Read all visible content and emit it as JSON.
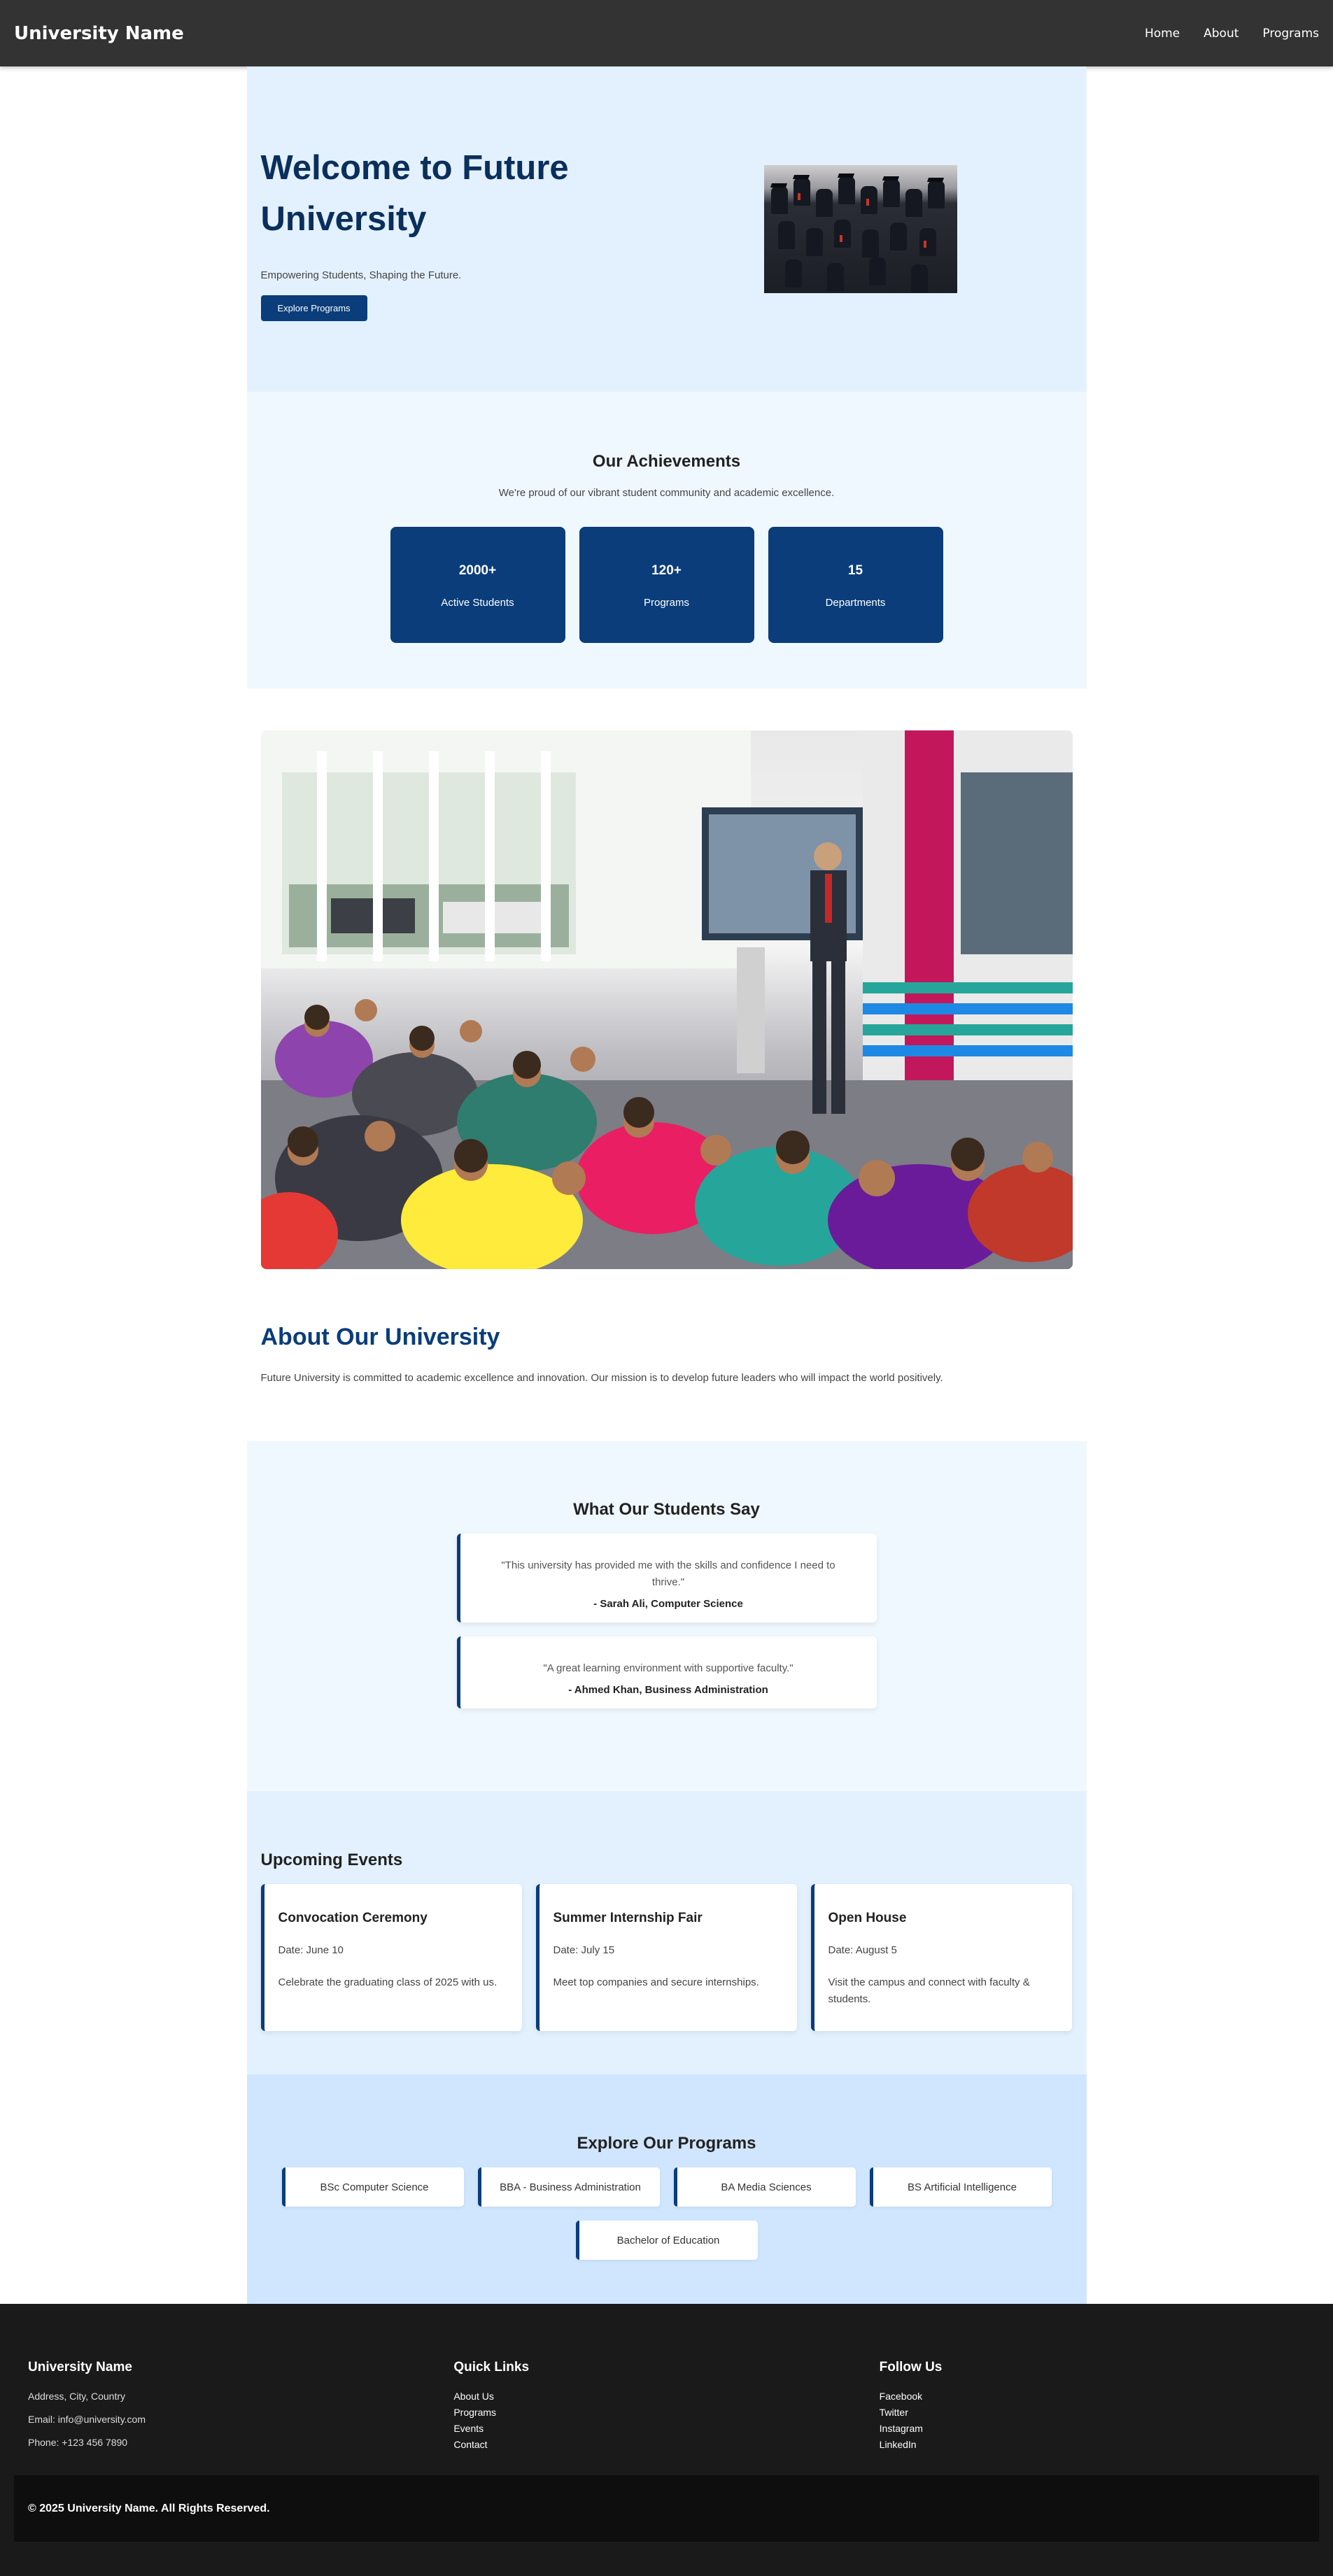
{
  "nav": {
    "brand": "University Name",
    "links": [
      "Home",
      "About",
      "Programs"
    ]
  },
  "hero": {
    "title": "Welcome to Future University",
    "subtitle": "Empowering Students, Shaping the Future.",
    "button": "Explore Programs",
    "image": "graduates-photo"
  },
  "achievements": {
    "title": "Our Achievements",
    "subtitle": "We're proud of our vibrant student community and academic excellence.",
    "stats": [
      {
        "value": "2000+",
        "label": "Active Students"
      },
      {
        "value": "120+",
        "label": "Programs"
      },
      {
        "value": "15",
        "label": "Departments"
      }
    ]
  },
  "lecture": {
    "image": "lecture-hall-photo"
  },
  "about": {
    "title": "About Our University",
    "text": "Future University is committed to academic excellence and innovation. Our mission is to develop future leaders who will impact the world positively."
  },
  "testimonials": {
    "title": "What Our Students Say",
    "items": [
      {
        "quote": "\"This university has provided me with the skills and confidence I need to thrive.\"",
        "author": "- Sarah Ali, Computer Science"
      },
      {
        "quote": "\"A great learning environment with supportive faculty.\"",
        "author": "- Ahmed Khan, Business Administration"
      }
    ]
  },
  "events": {
    "title": "Upcoming Events",
    "items": [
      {
        "name": "Convocation Ceremony",
        "date": "Date: June 10",
        "desc": "Celebrate the graduating class of 2025 with us."
      },
      {
        "name": "Summer Internship Fair",
        "date": "Date: July 15",
        "desc": "Meet top companies and secure internships."
      },
      {
        "name": "Open House",
        "date": "Date: August 5",
        "desc": "Visit the campus and connect with faculty & students."
      }
    ]
  },
  "programs": {
    "title": "Explore Our Programs",
    "items": [
      "BSc Computer Science",
      "BBA - Business Administration",
      "BA Media Sciences",
      "BS Artificial Intelligence",
      "Bachelor of Education"
    ]
  },
  "footer": {
    "col1": {
      "title": "University Name",
      "address": "Address, City, Country",
      "email": "Email: info@university.com",
      "phone": "Phone: +123 456 7890"
    },
    "col2": {
      "title": "Quick Links",
      "links": [
        "About Us",
        "Programs",
        "Events",
        "Contact"
      ]
    },
    "col3": {
      "title": "Follow Us",
      "links": [
        "Facebook",
        "Twitter",
        "Instagram",
        "LinkedIn"
      ]
    },
    "copyright": "© 2025 University Name. All Rights Reserved."
  },
  "colors": {
    "primary": "#0a3d7a",
    "nav": "#333333",
    "heroBg": "#e3f1ff",
    "footer": "#1a1a1a"
  }
}
